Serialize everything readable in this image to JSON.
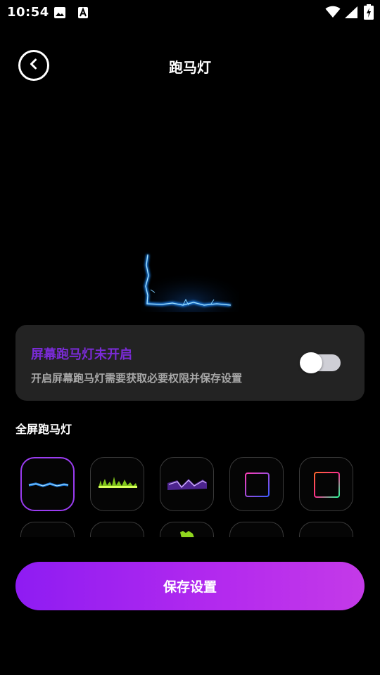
{
  "status_bar": {
    "time": "10:54",
    "icons": [
      "image-icon",
      "text-a-icon",
      "wifi-icon",
      "signal-icon",
      "battery-charging-icon"
    ]
  },
  "header": {
    "title": "跑马灯",
    "back_icon": "back-arrow-icon"
  },
  "permission_card": {
    "title": "屏幕跑马灯未开启",
    "description": "开启屏幕跑马灯需要获取必要权限并保存设置",
    "toggle_on": false
  },
  "section": {
    "title": "全屏跑马灯"
  },
  "effects": [
    {
      "name": "blue-lightning",
      "selected": true
    },
    {
      "name": "green-flame",
      "selected": false
    },
    {
      "name": "purple-lightning",
      "selected": false
    },
    {
      "name": "pink-blue-frame",
      "selected": false
    },
    {
      "name": "rainbow-frame",
      "selected": false
    },
    {
      "name": "effect-6",
      "selected": false
    },
    {
      "name": "effect-7",
      "selected": false
    },
    {
      "name": "effect-8",
      "selected": false
    },
    {
      "name": "effect-9",
      "selected": false
    },
    {
      "name": "effect-10",
      "selected": false
    }
  ],
  "colors": {
    "accent": "#9a3cf0",
    "title_purple": "#7a2bd6",
    "card_bg": "#232323",
    "button_gradient_start": "#8e1cf2",
    "button_gradient_end": "#c43ae8"
  },
  "save_button": {
    "label": "保存设置"
  }
}
